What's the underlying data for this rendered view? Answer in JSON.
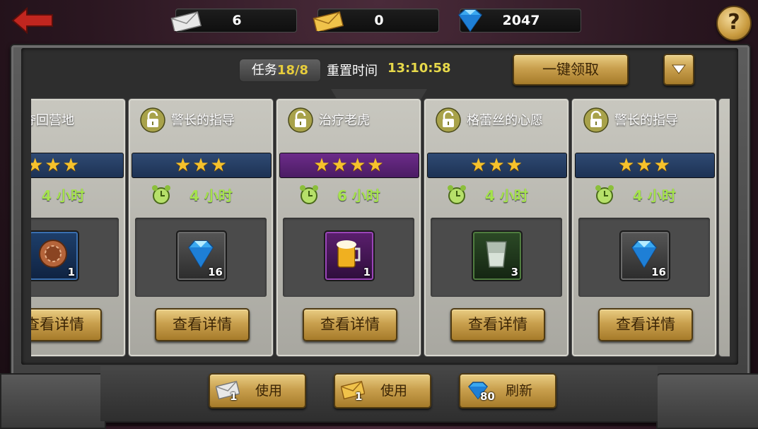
{
  "resources": [
    {
      "name": "mail-white",
      "value": "6"
    },
    {
      "name": "mail-gold",
      "value": "0"
    },
    {
      "name": "diamond",
      "value": "2047"
    }
  ],
  "help_label": "?",
  "header": {
    "task_label": "任务",
    "task_count": "18/8",
    "reset_label": "重置时间",
    "reset_time": "13:10:58",
    "claim_all_label": "一键领取"
  },
  "cards": [
    {
      "title": "夺回营地",
      "rarity": "blue",
      "stars": 3,
      "duration": "4 小时",
      "reward_icon": "chip-icon",
      "reward_slot": "blue",
      "reward_qty": "1",
      "detail_label": "查看详情"
    },
    {
      "title": "警长的指导",
      "rarity": "blue",
      "stars": 3,
      "duration": "4 小时",
      "reward_icon": "diamond-icon",
      "reward_slot": "gray",
      "reward_qty": "16",
      "detail_label": "查看详情"
    },
    {
      "title": "治疗老虎",
      "rarity": "purple",
      "stars": 4,
      "duration": "6 小时",
      "reward_icon": "beer-icon",
      "reward_slot": "purple",
      "reward_qty": "1",
      "detail_label": "查看详情"
    },
    {
      "title": "格蕾丝的心愿",
      "rarity": "blue",
      "stars": 3,
      "duration": "4 小时",
      "reward_icon": "glass-icon",
      "reward_slot": "green",
      "reward_qty": "3",
      "detail_label": "查看详情"
    },
    {
      "title": "警长的指导",
      "rarity": "blue",
      "stars": 3,
      "duration": "4 小时",
      "reward_icon": "diamond-icon",
      "reward_slot": "gray",
      "reward_qty": "16",
      "detail_label": "查看详情"
    }
  ],
  "bottom": [
    {
      "icon": "mail-white-icon",
      "qty": "1",
      "label": "使用"
    },
    {
      "icon": "mail-gold-icon",
      "qty": "1",
      "label": "使用"
    },
    {
      "icon": "diamond-icon",
      "qty": "80",
      "label": "刷新"
    }
  ],
  "colors": {
    "accent_gold": "#c9a04e",
    "time_green": "#a5e34c",
    "task_yellow": "#e6cc3c",
    "rare_blue": "#1d3254",
    "epic_purple": "#4b1c63"
  }
}
